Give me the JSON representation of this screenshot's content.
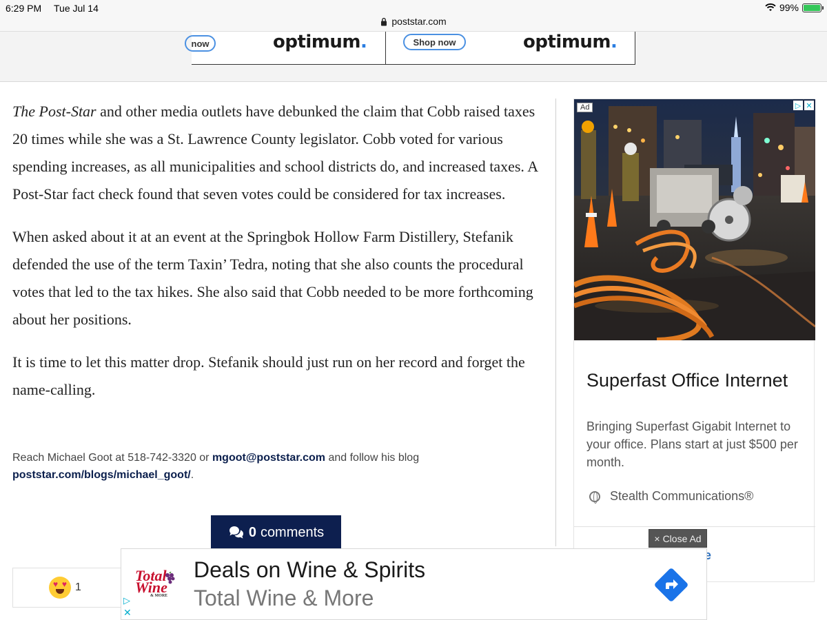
{
  "status_bar": {
    "time": "6:29 PM",
    "date": "Tue Jul 14",
    "battery": "99%"
  },
  "browser": {
    "url": "poststar.com"
  },
  "top_ad": {
    "left_button": "now",
    "right_button": "Shop now",
    "brand_left": "optimum",
    "brand_right": "optimum"
  },
  "article": {
    "para1_em": "The Post-Star",
    "para1_rest": " and other media outlets have debunked the claim that Cobb raised taxes 20 times while she was a St. Lawrence County legislator. Cobb voted for various spending increases, as all municipalities and school districts do, and increased taxes. A Post-Star fact check found that seven votes could be considered for tax increases.",
    "para2": "When asked about it at an event at the Springbok Hollow Farm Distillery, Stefanik defended the use of the term Taxin’ Tedra, noting that she also counts the procedural votes that led to the tax hikes. She also said that Cobb needed to be more forthcoming about her positions.",
    "para3": "It is time to let this matter drop. Stefanik should just run on her record and forget the name-calling."
  },
  "reach": {
    "prefix": "Reach Michael Goot at 518-742-3320 or ",
    "email": "mgoot@poststar.com",
    "middle": " and follow his blog ",
    "blog": "poststar.com/blogs/michael_goot/",
    "suffix": "."
  },
  "comments": {
    "count": "0",
    "label": "comments"
  },
  "reaction": {
    "count": "1"
  },
  "side_ad": {
    "badge": "Ad",
    "title": "Superfast Office Internet",
    "description": "Bringing Superfast Gigabit Internet to your office. Plans start at just $500 per month.",
    "source": "Stealth Communications®",
    "cta_partial": "ote"
  },
  "close_ad": {
    "label": "Close Ad"
  },
  "bottom_ad": {
    "logo_line1": "Total",
    "logo_line2": "Wine",
    "logo_tag": "& MORE",
    "title": "Deals on Wine & Spirits",
    "subtitle": "Total Wine & More"
  }
}
